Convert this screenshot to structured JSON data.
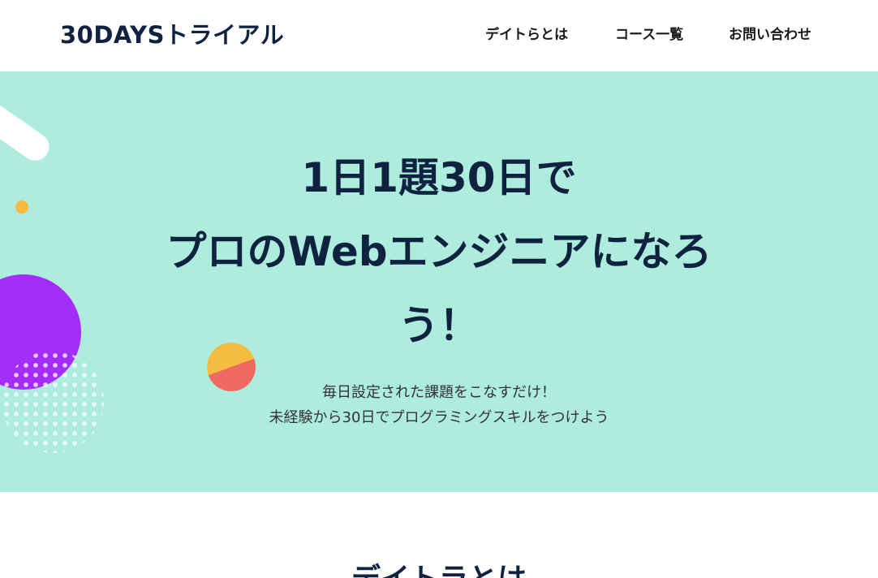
{
  "header": {
    "logo": "30DAYSトライアル",
    "nav": [
      "デイトらとは",
      "コース一覧",
      "お問い合わせ"
    ]
  },
  "hero": {
    "title_lines": [
      "1日1題30日で",
      "プロのWebエンジニアになろ",
      "う！"
    ],
    "subtitle_lines": [
      "毎日設定された課題をこなすだけ！",
      "未経験から30日でプログラミングスキルをつけよう"
    ]
  },
  "section": {
    "heading": "デイトラとは"
  },
  "colors": {
    "hero_bg": "#aeeddd",
    "navy": "#0f2340",
    "purple": "#a52dfa",
    "yellow": "#f5be42",
    "coral": "#ee6a63"
  }
}
